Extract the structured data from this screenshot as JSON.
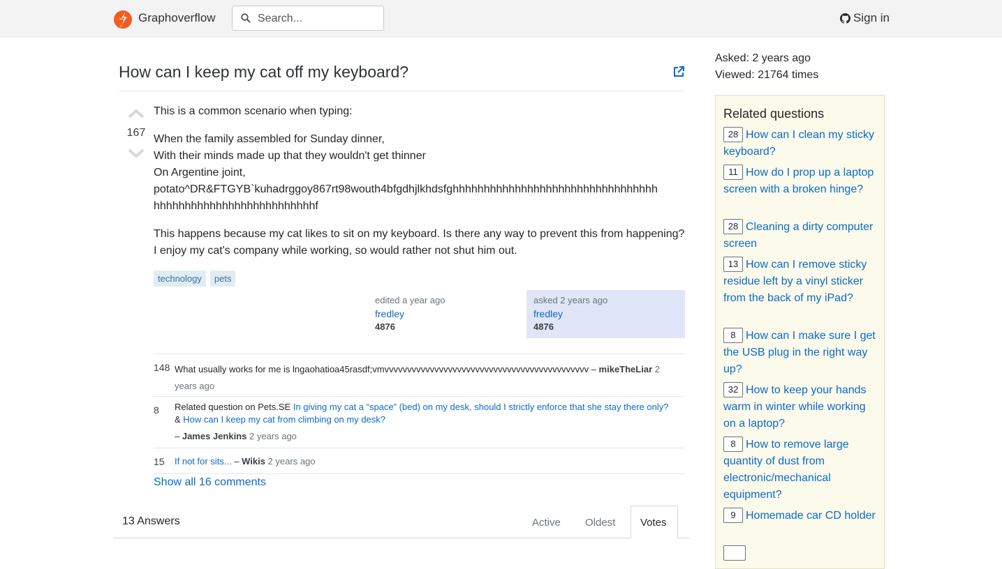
{
  "header": {
    "brand": "Graphoverflow",
    "search_placeholder": "Search...",
    "signin": "Sign in",
    "accent": "#f25c1f"
  },
  "question": {
    "title": "How can I keep my cat off my keyboard?",
    "votes": "167",
    "intro": "This is a common scenario when typing:",
    "verse": [
      "When the family assembled for Sunday dinner,",
      "With their minds made up that they wouldn't get thinner",
      "On Argentine joint,",
      "potato^DR&FTGYB`kuhadrggoy867rt98wouth4bfgdhjlkhdsfghhhhhhhhhhhhhhhhhhhhhhhhhhhhhhhhh",
      "hhhhhhhhhhhhhhhhhhhhhhhhhhf"
    ],
    "body": "This happens because my cat likes to sit on my keyboard. Is there any way to prevent this from happening? I enjoy my cat's company while working, so would rather not shut him out.",
    "tags": [
      "technology",
      "pets"
    ],
    "edited": {
      "label": "edited a year ago",
      "user": "fredley",
      "rep": "4876"
    },
    "asked": {
      "label": "asked 2 years ago",
      "user": "fredley",
      "rep": "4876"
    }
  },
  "comments": [
    {
      "score": "148",
      "text": "What usually works for me is lngaohatioa45rasdf;vmvvvvvvvvvvvvvvvvvvvvvvvvvvvvvvvvvvvvvvvvvvvvv",
      "author": "mikeTheLiar",
      "date_start": "2",
      "date_end": "years ago"
    },
    {
      "score": "8",
      "prefix": "Related question on Pets.SE ",
      "link1": "In giving my cat a “space” (bed) on my desk, should I strictly enforce that she stay there only?",
      "joiner": " & ",
      "link2": "How can I keep my cat from climbing on my desk?",
      "author": "James Jenkins",
      "date": "2 years ago"
    },
    {
      "score": "15",
      "link": "If not for sits...",
      "author": "Wikis",
      "date": "2 years ago"
    }
  ],
  "show_all": "Show all 16 comments",
  "answers": {
    "count_label": "13 Answers",
    "tabs": [
      "Active",
      "Oldest",
      "Votes"
    ],
    "active_tab": "Votes"
  },
  "sidebar": {
    "asked": "Asked: 2 years ago",
    "viewed": "Viewed: 21764 times",
    "related_title": "Related questions",
    "related": [
      {
        "score": "28",
        "title": "How can I clean my sticky keyboard?"
      },
      {
        "score": "11",
        "title": "How do I prop up a laptop screen with a broken hinge?"
      },
      {
        "score": "28",
        "title": "Cleaning a dirty computer screen"
      },
      {
        "score": "13",
        "title": "How can I remove sticky residue left by a vinyl sticker from the back of my iPad?"
      },
      {
        "score": "8",
        "title": "How can I make sure I get the USB plug in the right way up?"
      },
      {
        "score": "32",
        "title": "How to keep your hands warm in winter while working on a laptop?"
      },
      {
        "score": "8",
        "title": "How to remove large quantity of dust from electronic/mechanical equipment?"
      },
      {
        "score": "9",
        "title": "Homemade car CD holder"
      }
    ]
  }
}
